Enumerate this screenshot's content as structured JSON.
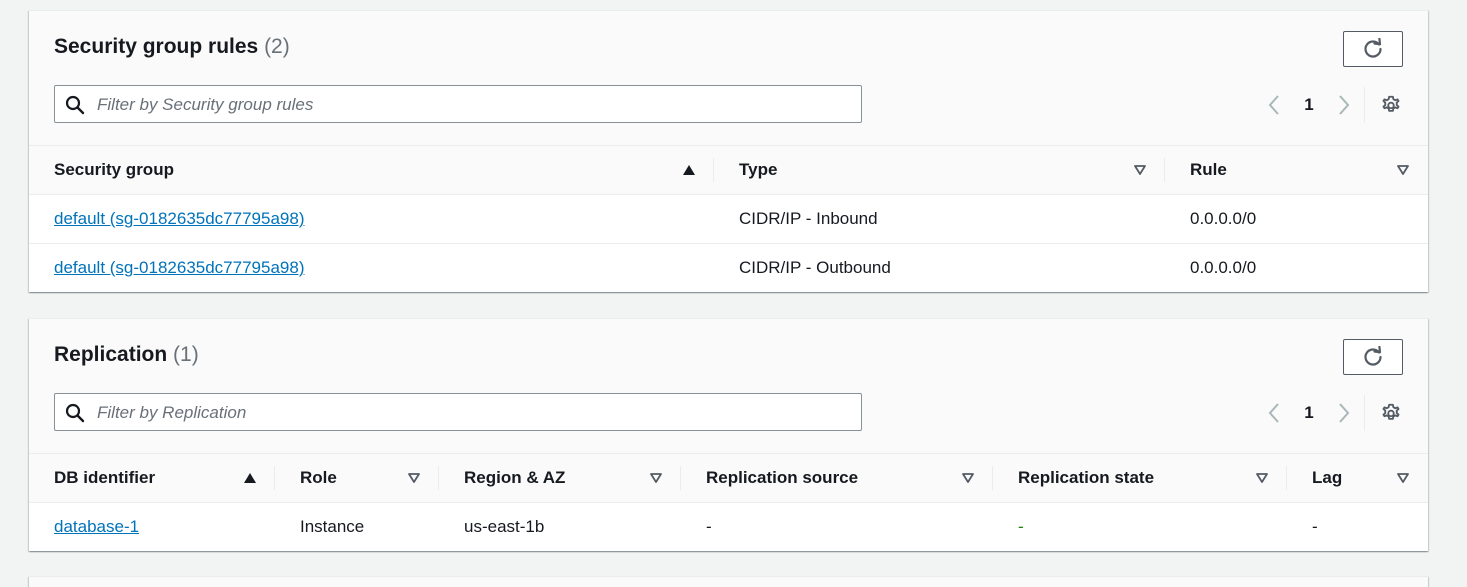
{
  "sg_panel": {
    "title": "Security group rules",
    "count": "(2)",
    "filter_placeholder": "Filter by Security group rules",
    "page": "1",
    "columns": [
      "Security group",
      "Type",
      "Rule"
    ],
    "rows": [
      {
        "group": "default (sg-0182635dc77795a98)",
        "type": "CIDR/IP - Inbound",
        "rule": "0.0.0.0/0"
      },
      {
        "group": "default (sg-0182635dc77795a98)",
        "type": "CIDR/IP - Outbound",
        "rule": "0.0.0.0/0"
      }
    ]
  },
  "replication_panel": {
    "title": "Replication",
    "count": "(1)",
    "filter_placeholder": "Filter by Replication",
    "page": "1",
    "columns": [
      "DB identifier",
      "Role",
      "Region & AZ",
      "Replication source",
      "Replication state",
      "Lag"
    ],
    "rows": [
      {
        "db": "database-1",
        "role": "Instance",
        "region": "us-east-1b",
        "source": "-",
        "state": "-",
        "lag": "-"
      }
    ]
  },
  "icons": {
    "refresh": "refresh-icon",
    "search": "search-icon",
    "prev": "chevron-left-icon",
    "next": "chevron-right-icon",
    "settings": "gear-icon",
    "sort_asc": "sort-ascending-icon",
    "sort_none": "sort-caret-down-icon"
  },
  "colors": {
    "link": "#0073bb",
    "state_ok": "#1d8102",
    "page_bg": "#f2f3f3"
  }
}
